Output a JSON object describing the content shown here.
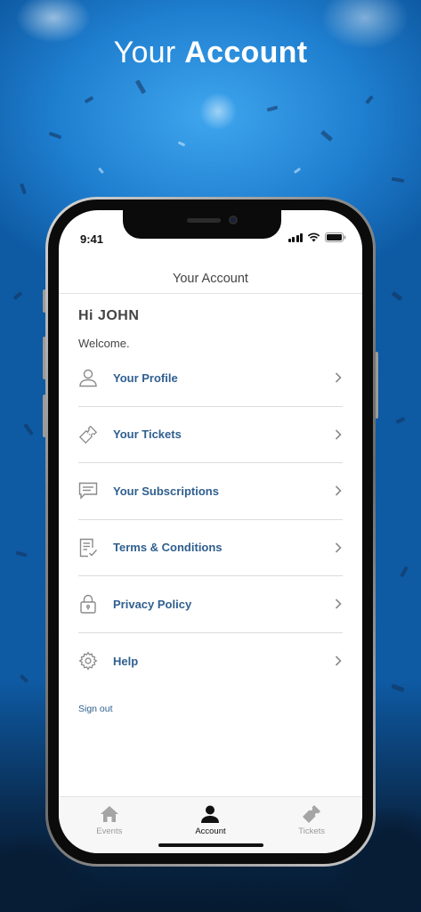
{
  "headline": {
    "regular": "Your ",
    "bold": "Account"
  },
  "status_bar": {
    "time": "9:41"
  },
  "nav": {
    "title": "Your Account"
  },
  "account": {
    "greeting": "Hi JOHN",
    "welcome": "Welcome."
  },
  "menu": [
    {
      "label": "Your Profile",
      "icon": "user-icon"
    },
    {
      "label": "Your Tickets",
      "icon": "ticket-icon"
    },
    {
      "label": "Your Subscriptions",
      "icon": "message-icon"
    },
    {
      "label": "Terms & Conditions",
      "icon": "document-check-icon"
    },
    {
      "label": "Privacy Policy",
      "icon": "lock-icon"
    },
    {
      "label": "Help",
      "icon": "gear-icon"
    }
  ],
  "signout": "Sign out",
  "tabs": [
    {
      "label": "Events",
      "icon": "home-icon",
      "active": false
    },
    {
      "label": "Account",
      "icon": "user-filled-icon",
      "active": true
    },
    {
      "label": "Tickets",
      "icon": "ticket-filled-icon",
      "active": false
    }
  ],
  "colors": {
    "accent": "#2f5f8f",
    "background_blue": "#1f7fd0",
    "tab_inactive": "#9a9a9a"
  }
}
